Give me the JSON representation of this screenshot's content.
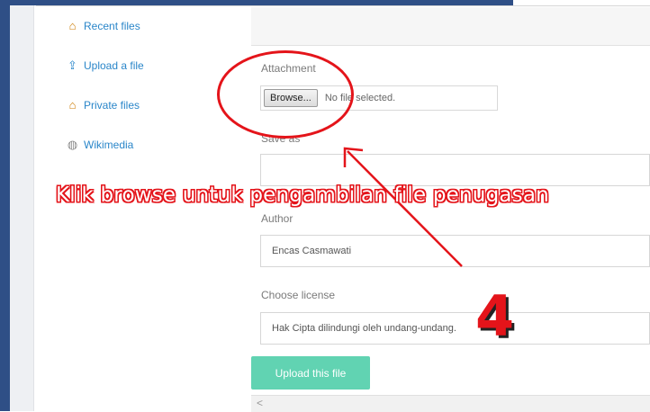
{
  "sidebar": {
    "items": [
      {
        "label": "Recent files",
        "icon": "house-icon"
      },
      {
        "label": "Upload a file",
        "icon": "upload-icon"
      },
      {
        "label": "Private files",
        "icon": "house-icon"
      },
      {
        "label": "Wikimedia",
        "icon": "globe-icon"
      }
    ]
  },
  "form": {
    "attachment_label": "Attachment",
    "browse_label": "Browse...",
    "no_file_text": "No file selected.",
    "save_as_label": "Save as",
    "save_as_value": "",
    "author_label": "Author",
    "author_value": "Encas Casmawati",
    "license_label": "Choose license",
    "license_value": "Hak Cipta dilindungi oleh undang-undang.",
    "upload_button": "Upload this file"
  },
  "annotation": {
    "instruction": "Klik browse untuk pengambilan file penugasan",
    "step": "4",
    "color": "#e4141a"
  },
  "scrollbar": {
    "left_arrow": "<"
  }
}
